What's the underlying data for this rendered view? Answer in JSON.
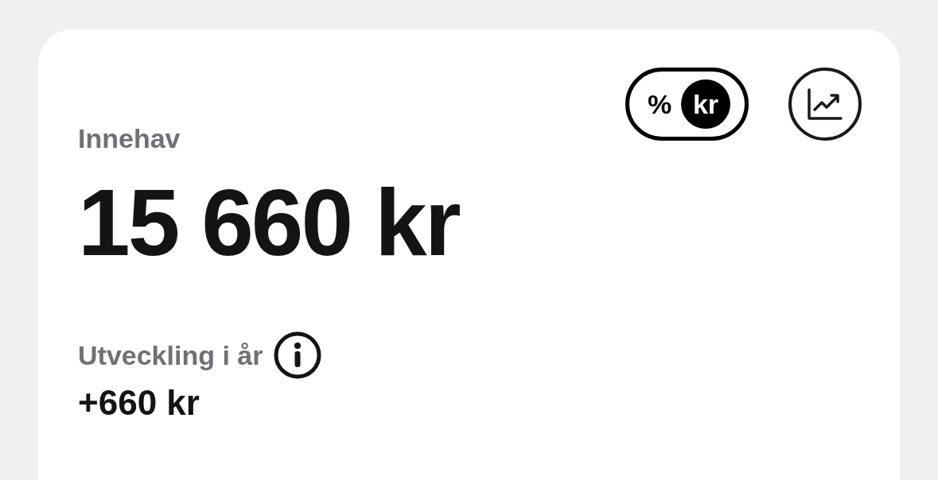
{
  "unit_toggle": [
    {
      "label": "%",
      "selected": false
    },
    {
      "label": "kr",
      "selected": true
    }
  ],
  "holdings": {
    "label": "Innehav",
    "value": "15 660 kr"
  },
  "development": {
    "label": "Utveckling i år",
    "value": "+660 kr"
  }
}
